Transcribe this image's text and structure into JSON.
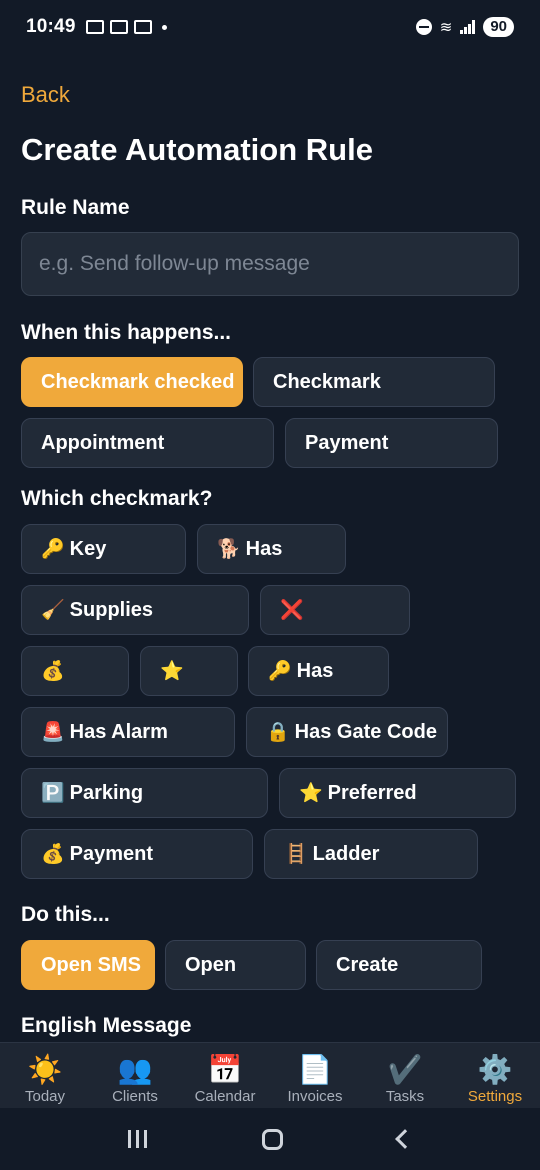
{
  "status_bar": {
    "time": "10:49",
    "battery": "90"
  },
  "header": {
    "back_label": "Back",
    "title": "Create Automation Rule"
  },
  "rule_name": {
    "label": "Rule Name",
    "placeholder": "e.g. Send follow-up message"
  },
  "trigger": {
    "label": "When this happens...",
    "options": [
      "Checkmark checked",
      "Checkmark",
      "Appointment",
      "Payment"
    ],
    "selected": "Checkmark checked"
  },
  "checkmark": {
    "label": "Which checkmark?",
    "options": [
      {
        "icon": "🔑",
        "label": "Key"
      },
      {
        "icon": "🐕",
        "label": "Has"
      },
      {
        "icon": "🧹",
        "label": "Supplies"
      },
      {
        "icon": "❌",
        "label": ""
      },
      {
        "icon": "💰",
        "label": ""
      },
      {
        "icon": "⭐",
        "label": ""
      },
      {
        "icon": "🔑",
        "label": "Has"
      },
      {
        "icon": "🚨",
        "label": "Has Alarm"
      },
      {
        "icon": "🔒",
        "label": "Has Gate Code"
      },
      {
        "icon": "🅿️",
        "label": "Parking"
      },
      {
        "icon": "⭐",
        "label": "Preferred"
      },
      {
        "icon": "💰",
        "label": "Payment"
      },
      {
        "icon": "🪜",
        "label": "Ladder"
      }
    ]
  },
  "action": {
    "label": "Do this...",
    "options": [
      "Open SMS",
      "Open",
      "Create"
    ],
    "selected": "Open SMS"
  },
  "message": {
    "label": "English Message"
  },
  "bottom_nav": [
    {
      "icon": "☀️",
      "label": "Today"
    },
    {
      "icon": "👥",
      "label": "Clients"
    },
    {
      "icon": "📅",
      "label": "Calendar"
    },
    {
      "icon": "📄",
      "label": "Invoices"
    },
    {
      "icon": "✔️",
      "label": "Tasks"
    },
    {
      "icon": "⚙️",
      "label": "Settings"
    }
  ],
  "colors": {
    "accent": "#f0a93b",
    "background": "#121a27",
    "chip": "#212a37"
  }
}
